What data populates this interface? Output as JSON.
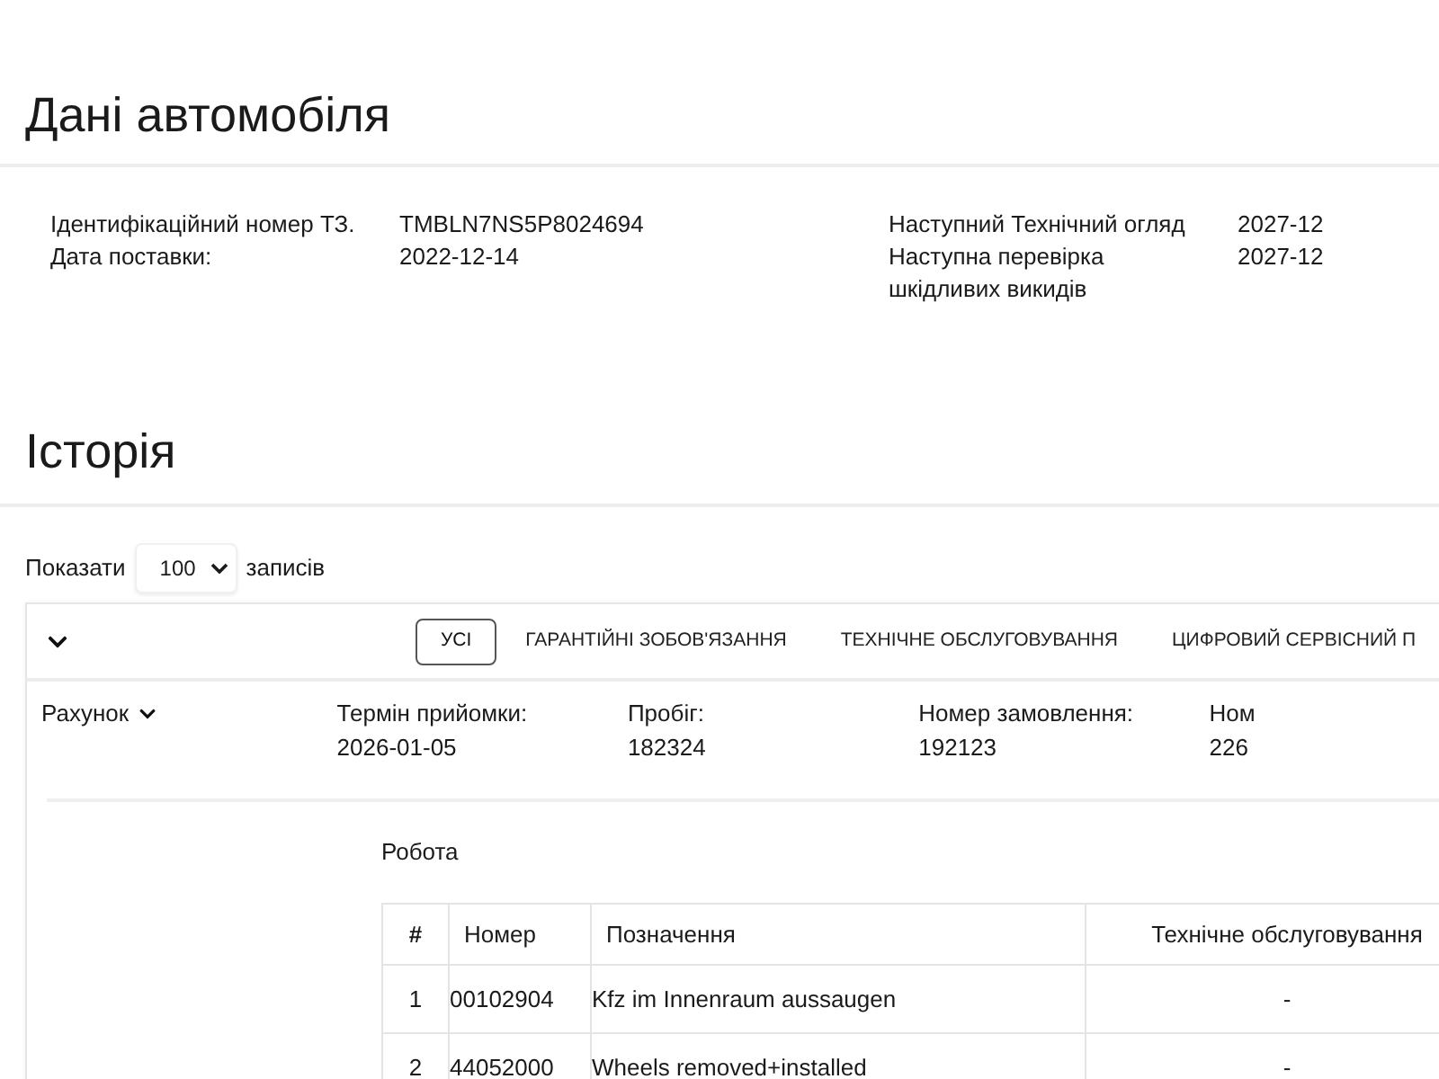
{
  "title": "Дані автомобіля",
  "vehicle_info": {
    "left": [
      {
        "label": "Ідентифікаційний номер ТЗ.",
        "value": "TMBLN7NS5P8024694"
      },
      {
        "label": "Дата поставки:",
        "value": "2022-12-14"
      }
    ],
    "right": [
      {
        "label": "Наступний Технічний огляд",
        "value": "2027-12"
      },
      {
        "label": "Наступна перевірка шкідливих викидів",
        "value": "2027-12"
      }
    ]
  },
  "history": {
    "title": "Історія",
    "page_length": {
      "label_before": "Показати",
      "value": "100",
      "label_after": "записів"
    },
    "filter_tabs": [
      {
        "label": "УСІ",
        "selected": true
      },
      {
        "label": "ГАРАНТІЙНІ ЗОБОВ'ЯЗАННЯ",
        "selected": false
      },
      {
        "label": "ТЕХНІЧНЕ ОБСЛУГОВУВАННЯ",
        "selected": false
      },
      {
        "label": "ЦИФРОВИЙ СЕРВІСНИЙ П",
        "selected": false
      }
    ],
    "entry": {
      "title": "Рахунок",
      "fields": [
        {
          "label": "Термін прийомки:",
          "value": "2026-01-05"
        },
        {
          "label": "Пробіг:",
          "value": "182324"
        },
        {
          "label": "Номер замовлення:",
          "value": "192123"
        },
        {
          "label": "Ном",
          "value": "226"
        }
      ],
      "work": {
        "title": "Робота",
        "table": {
          "columns": [
            "#",
            "Номер",
            "Позначення",
            "Технічне обслуговування"
          ],
          "rows": [
            [
              "1",
              "00102904",
              "Kfz im Innenraum aussaugen",
              "-"
            ],
            [
              "2",
              "44052000",
              "Wheels removed+installed",
              "-"
            ]
          ]
        }
      }
    }
  }
}
